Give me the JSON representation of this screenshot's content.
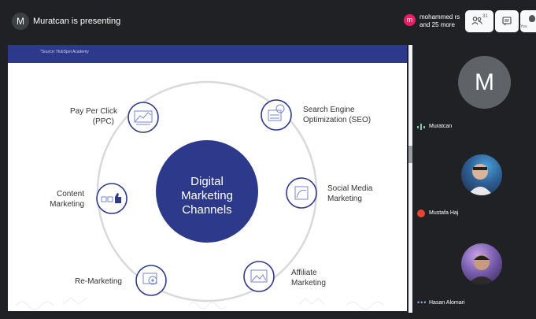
{
  "topbar": {
    "presenter_initial": "M",
    "presenting_text": "Muratcan is presenting",
    "participant_initial": "m",
    "participant_name": "mohammed rs",
    "participant_more": "and 25 more",
    "people_count": "31",
    "you_label": "You"
  },
  "slide": {
    "source": "\"Source: HubSpot Academy",
    "center": [
      "Digital",
      "Marketing",
      "Channels"
    ],
    "channels": [
      {
        "label": [
          "Pay Per Click",
          "(PPC)"
        ],
        "icon": "chart-icon"
      },
      {
        "label": [
          "Search Engine",
          "Optimization (SEO)"
        ],
        "icon": "gear-icon"
      },
      {
        "label": [
          "Social Media",
          "Marketing"
        ],
        "icon": "photo-icon"
      },
      {
        "label": [
          "Affiliate",
          "Marketing"
        ],
        "icon": "image-icon"
      },
      {
        "label": [
          "Re-Marketing"
        ],
        "icon": "target-icon"
      },
      {
        "label": [
          "Content",
          "Marketing"
        ],
        "icon": "thumbs-up-icon"
      }
    ]
  },
  "participants": [
    {
      "name": "Muratcan",
      "initial": "M",
      "status": "speaking"
    },
    {
      "name": "Mustafa Haj",
      "status": "muted"
    },
    {
      "name": "Hasan Alomari",
      "status": "more"
    }
  ],
  "colors": {
    "navy": "#2d3a8c",
    "ring": "#d8d8d8",
    "meet_dark": "#202124",
    "muted_red": "#ea4335",
    "speaking_green": "#81c995"
  }
}
